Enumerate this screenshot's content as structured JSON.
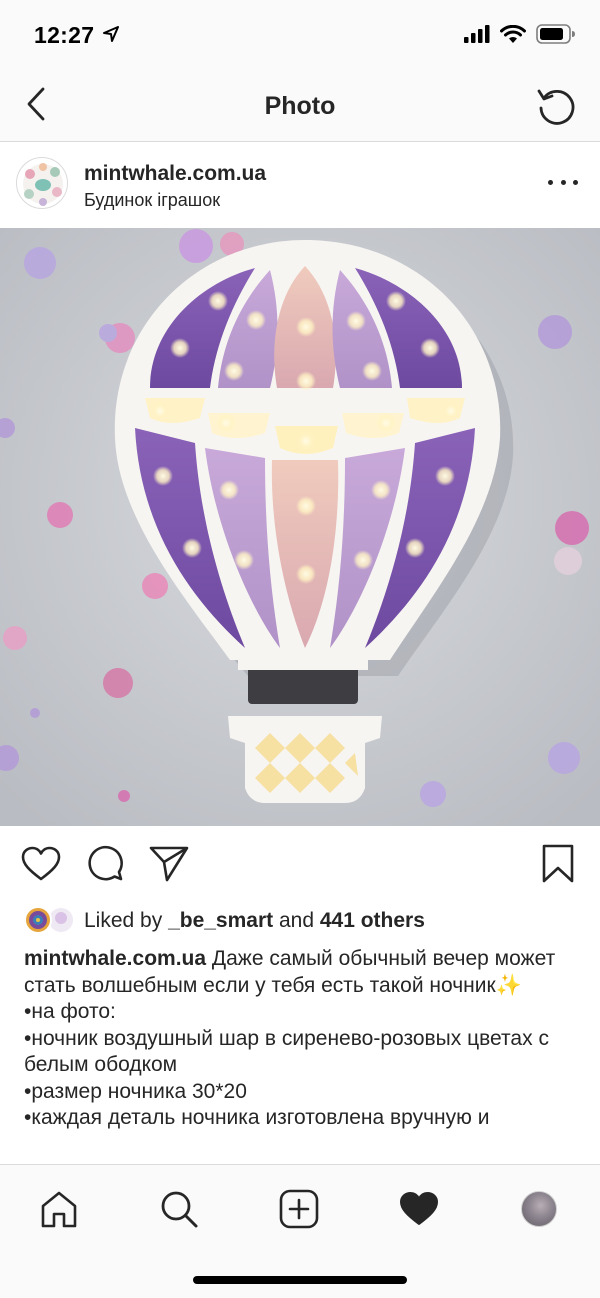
{
  "status": {
    "time": "12:27"
  },
  "nav": {
    "title": "Photo"
  },
  "post": {
    "username": "mintwhale.com.ua",
    "location": "Будинок іграшок"
  },
  "likes": {
    "prefix": "Liked by ",
    "user": "_be_smart",
    "middle": " and ",
    "count_text": "441 others"
  },
  "caption": {
    "username": "mintwhale.com.ua",
    "line1": " Даже самый обычный вечер может стать волшебным если у тебя есть такой ночник✨",
    "line2": "•на фото:",
    "line3": "•ночник воздушный шар в сиренево-розовых цветах с белым ободком",
    "line4": "•размер ночника 30*20",
    "line5": "•каждая деталь ночника изготовлена вручную и"
  },
  "icons": {
    "status": [
      "location-arrow-icon",
      "signal-icon",
      "wifi-icon",
      "battery-icon"
    ],
    "nav": [
      "back-icon",
      "refresh-icon"
    ],
    "actions": [
      "heart-icon",
      "comment-icon",
      "share-icon",
      "bookmark-icon"
    ],
    "tabs": [
      "home-icon",
      "search-icon",
      "add-icon",
      "activity-heart-icon",
      "profile-avatar"
    ]
  },
  "colors": {
    "text": "#262626",
    "divider": "#dbdbdb",
    "bar_bg": "#fafafa"
  }
}
